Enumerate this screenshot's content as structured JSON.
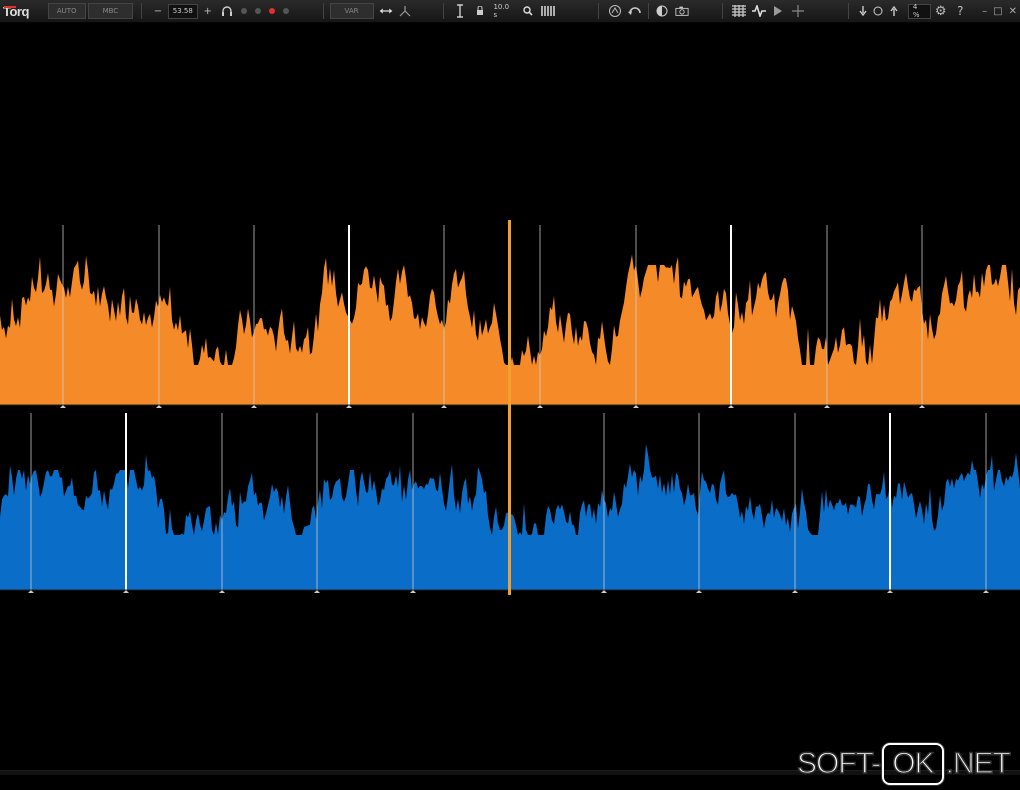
{
  "app": {
    "name": "Torq"
  },
  "toolbar": {
    "auto_label": "AUTO",
    "mbc_label": "MBC",
    "minus": "−",
    "tempo": "53.58",
    "plus": "+",
    "var_label": "VAR",
    "zoom": "10.0 s",
    "cpu": "4 %",
    "settings": "⚙",
    "help": "?",
    "minimize": "–",
    "maximize": "□",
    "close": "✕"
  },
  "colors": {
    "deck_a": "#f58a28",
    "deck_b": "#0a6ec9",
    "playhead": "#f0a030",
    "background": "#000000"
  },
  "waveforms": [
    {
      "name": "deck-a",
      "color": "#f58a28",
      "beat_markers": [
        63,
        159,
        254,
        349,
        444,
        540,
        636,
        731,
        827,
        922
      ],
      "strong_markers": [
        349,
        731
      ]
    },
    {
      "name": "deck-b",
      "color": "#0a6ec9",
      "beat_markers": [
        31,
        126,
        222,
        317,
        413,
        604,
        699,
        795,
        890,
        986
      ],
      "strong_markers": [
        126,
        890
      ]
    }
  ],
  "watermark": {
    "left": "SOFT-",
    "mid": "OK",
    "right": ".NET"
  }
}
